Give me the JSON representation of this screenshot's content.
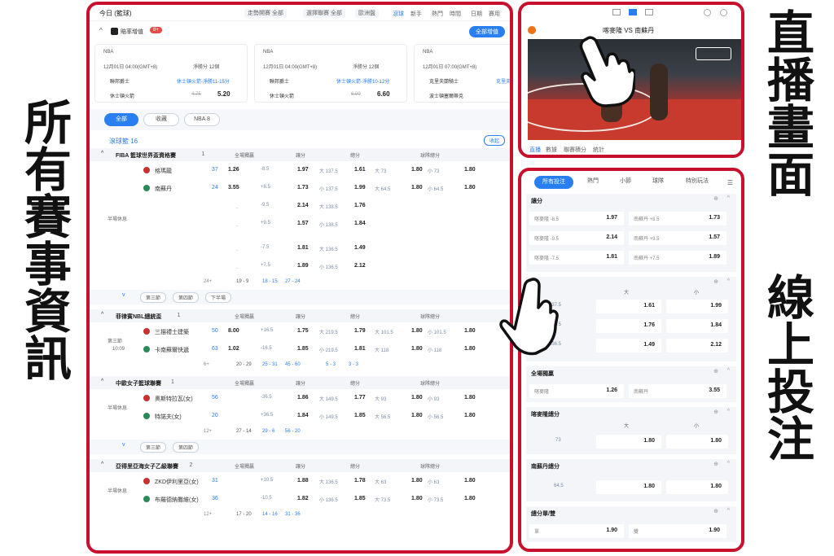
{
  "side_captions": {
    "left": "所有賽事資訊",
    "right_top": "直播畫面",
    "right_bottom": "線上投注"
  },
  "topbar": {
    "title": "今日 (籃球)",
    "filter1": "走勢開賽",
    "filter1_val": "全部",
    "filter2": "選擇聯賽",
    "filter2_val": "全部",
    "filter3": "歐洲盤",
    "tabs": [
      "滾球",
      "新手",
      "熱門",
      "時間",
      "日期",
      "賽用"
    ]
  },
  "promo": {
    "title": "賠率增值",
    "badge": "8+",
    "all_label": "全部增值"
  },
  "cards": [
    {
      "league": "NBA",
      "time": "12月01日 04:00(GMT+8)",
      "market": "淨勝分 12個",
      "team1": "聯邦爵士",
      "line": "休士頓火箭-淨勝11-15分",
      "team2": "休士頓火箭",
      "old": "4.75",
      "odds": "5.20"
    },
    {
      "league": "NBA",
      "time": "12月01日 04:00(GMT+8)",
      "market": "淨勝分 12個",
      "team1": "聯邦爵士",
      "line": "休士頓火箭-淨勝10-12分",
      "team2": "休士頓火箭",
      "old": "6.00",
      "odds": "6.60"
    },
    {
      "league": "NBA",
      "time": "12月01日 07:00(GMT+8)",
      "market": "淨勝分 14個",
      "team1": "克里夫蘭騎士",
      "line": "克里夫",
      "team2": "波士頓塞爾蒂克",
      "old": "",
      "odds": ""
    }
  ],
  "filters": [
    "全部",
    "收藏",
    "NBA 8"
  ],
  "live_label": "滾球籃 16",
  "collapse": "收起",
  "col_headers": [
    "全場獨贏",
    "讓分",
    "總分",
    "球隊總分"
  ],
  "leagues": [
    {
      "name": "FIBA 籃球世界盃資格賽",
      "count": "1",
      "status": "半場休息",
      "more": "24+",
      "score": "19 - 9",
      "q1": "18 - 15",
      "q2": "27 - 24",
      "teams": [
        {
          "name": "格瑪龍",
          "score": "37",
          "ml": "1.26",
          "hl": "-8.5",
          "ho": "1.97",
          "tl": "大 137.5",
          "to": "1.61",
          "b1": "大 73",
          "b1o": "1.80",
          "b2": "小 73",
          "b2o": "1.80"
        },
        {
          "name": "南蘇丹",
          "score": "24",
          "ml": "3.55",
          "hl": "+8.5",
          "ho": "1.73",
          "tl": "小 137.5",
          "to": "1.99",
          "b1": "大 64.5",
          "b1o": "1.80",
          "b2": "小 64.5",
          "b2o": "1.80"
        }
      ],
      "extra": [
        {
          "hl": "-9.5",
          "ho": "2.14",
          "tl": "大 138.5",
          "to": "1.76"
        },
        {
          "hl": "+9.5",
          "ho": "1.57",
          "tl": "小 138.5",
          "to": "1.84"
        },
        {
          "hl": "-7.5",
          "ho": "1.81",
          "tl": "大 136.5",
          "to": "1.49"
        },
        {
          "hl": "+7.5",
          "ho": "1.89",
          "tl": "小 136.5",
          "to": "2.12"
        }
      ],
      "tabs": [
        "第三節",
        "第四節",
        "下半場"
      ]
    },
    {
      "name": "菲律賓NBL總統盃",
      "count": "1",
      "status": "第三節",
      "clock": "10:09",
      "more": "6+",
      "score": "20 - 29",
      "q1": "25 - 31",
      "q2": "45 - 60",
      "q3": "5 - 3",
      "q4": "3 - 3",
      "teams": [
        {
          "name": "三描禮士建築",
          "score": "50",
          "ml": "8.00",
          "hl": "+16.5",
          "ho": "1.75",
          "tl": "大 219.5",
          "to": "1.79",
          "b1": "大 101.5",
          "b1o": "1.80",
          "b2": "小 101.5",
          "b2o": "1.80"
        },
        {
          "name": "卡南蘇爾快遞",
          "score": "63",
          "ml": "1.02",
          "hl": "-16.5",
          "ho": "1.85",
          "tl": "小 219.5",
          "to": "1.81",
          "b1": "大 118",
          "b1o": "1.80",
          "b2": "小 118",
          "b2o": "1.80"
        }
      ]
    },
    {
      "name": "中歐女子籃球聯賽",
      "count": "1",
      "status": "半場休息",
      "more": "12+",
      "score": "27 - 14",
      "q1": "29 - 6",
      "q2": "56 - 20",
      "teams": [
        {
          "name": "奧斯特拉瓦(女)",
          "score": "56",
          "ml": "",
          "hl": "-36.5",
          "ho": "1.86",
          "tl": "大 149.5",
          "to": "1.77",
          "b1": "大 93",
          "b1o": "1.80",
          "b2": "小 93",
          "b2o": "1.80"
        },
        {
          "name": "特諾夫(女)",
          "score": "20",
          "ml": "",
          "hl": "+36.5",
          "ho": "1.84",
          "tl": "小 149.5",
          "to": "1.85",
          "b1": "大 56.5",
          "b1o": "1.80",
          "b2": "小 56.5",
          "b2o": "1.80"
        }
      ],
      "tabs": [
        "第三節",
        "第四節"
      ]
    },
    {
      "name": "亞得里亞海女子乙級聯賽",
      "count": "2",
      "status": "半場休息",
      "more": "12+",
      "score": "17 - 20",
      "q1": "14 - 16",
      "q2": "31 - 36",
      "teams": [
        {
          "name": "ZKD伊利里亞(女)",
          "score": "31",
          "ml": "",
          "hl": "+10.5",
          "ho": "1.88",
          "tl": "大 136.5",
          "to": "1.78",
          "b1": "大 63",
          "b1o": "1.80",
          "b2": "小 63",
          "b2o": "1.80"
        },
        {
          "name": "布羅德納撒維(女)",
          "score": "36",
          "ml": "",
          "hl": "-10.5",
          "ho": "1.82",
          "tl": "小 136.5",
          "to": "1.85",
          "b1": "大 73.5",
          "b1o": "1.80",
          "b2": "小 73.5",
          "b2o": "1.80"
        }
      ]
    }
  ],
  "video": {
    "match": "喀麥隆 VS 南蘇丹",
    "tabs": [
      "直播",
      "數據",
      "聯賽積分",
      "統計"
    ],
    "side": "投注"
  },
  "bet": {
    "tabs": [
      "所有投注",
      "熱門",
      "小節",
      "球隊",
      "特別玩法"
    ],
    "spread": {
      "title": "讓分",
      "rows": [
        [
          "喀麥隆 -8.5",
          "1.97",
          "南蘇丹 +8.5",
          "1.73"
        ],
        [
          "喀麥隆 -9.5",
          "2.14",
          "南蘇丹 +9.5",
          "1.57"
        ],
        [
          "喀麥隆 -7.5",
          "1.81",
          "南蘇丹 +7.5",
          "1.89"
        ]
      ]
    },
    "total": {
      "big": "大",
      "small": "小",
      "rows": [
        [
          "137.5",
          "1.61",
          "1.99"
        ],
        [
          "138.5",
          "1.76",
          "1.84"
        ],
        [
          "136.5",
          "1.49",
          "2.12"
        ]
      ]
    },
    "moneyline": {
      "title": "全場獨贏",
      "rows": [
        [
          "喀麥隆",
          "1.26",
          "南蘇丹",
          "3.55"
        ]
      ]
    },
    "team1": {
      "title": "喀麥隆總分",
      "big": "大",
      "small": "小",
      "line": "73",
      "o1": "1.80",
      "o2": "1.80"
    },
    "team2": {
      "title": "南蘇丹總分",
      "line": "64.5",
      "o1": "1.80",
      "o2": "1.80"
    },
    "oddeven": {
      "title": "總分單/雙",
      "odd": "單",
      "oddv": "1.90",
      "even": "雙",
      "evenv": "1.90"
    }
  },
  "colors": {
    "frame": "#c8102e",
    "accent": "#2a7ff0",
    "red": "#e84a4a"
  }
}
